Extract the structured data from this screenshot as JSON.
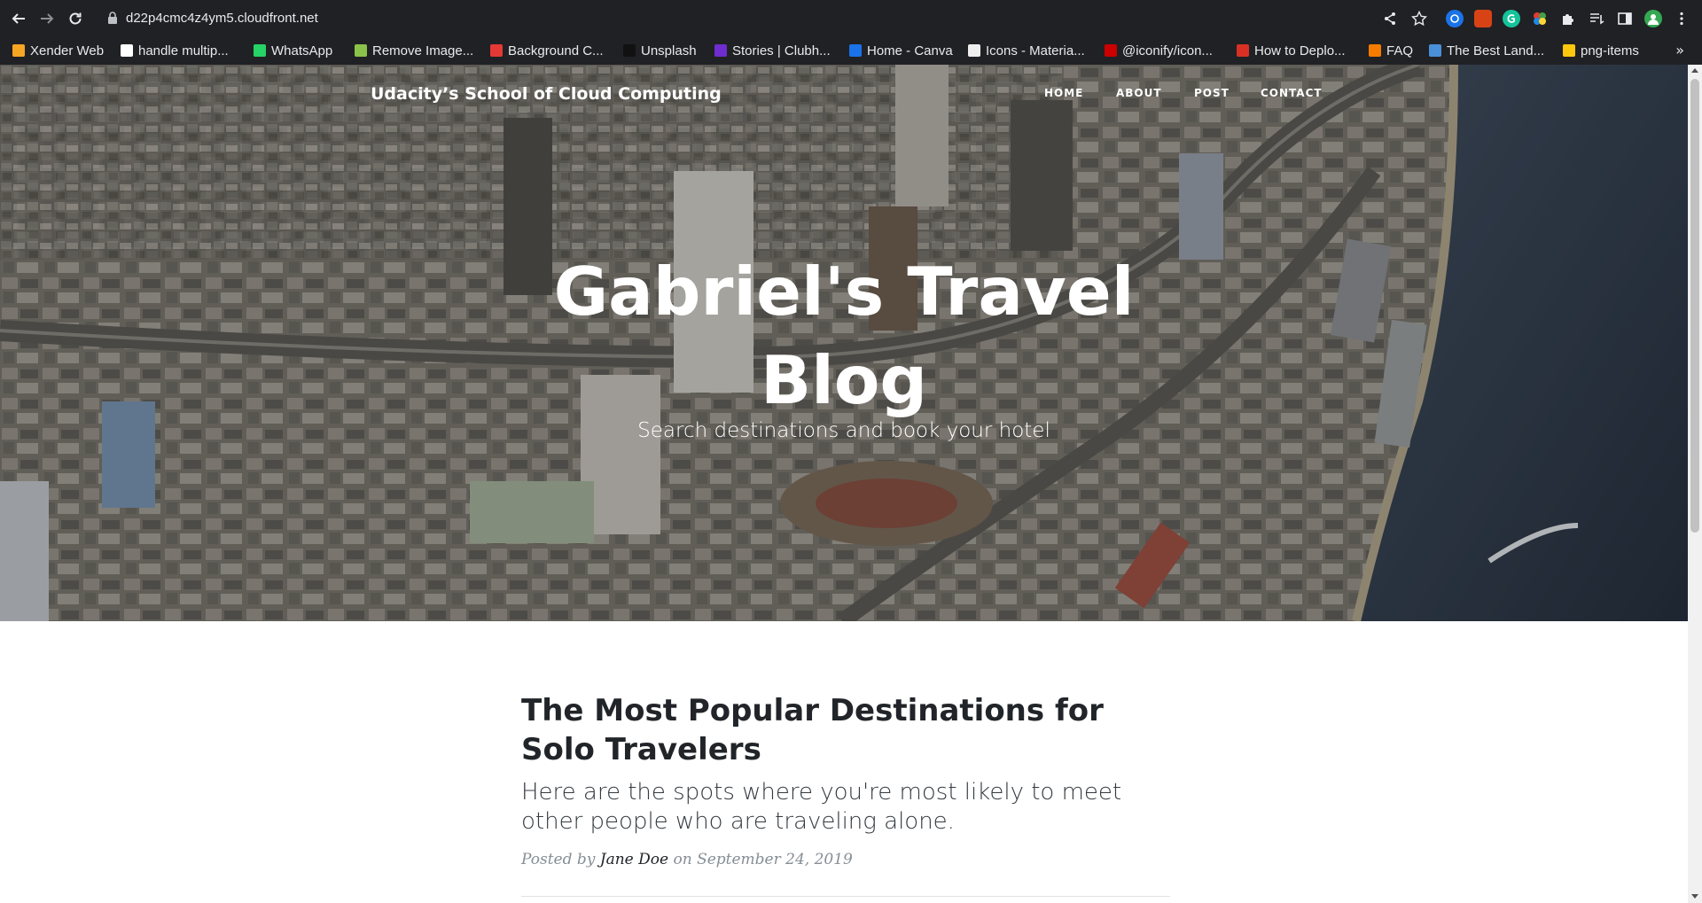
{
  "browser": {
    "url": "d22p4cmc4z4ym5.cloudfront.net",
    "bookmarks": [
      {
        "label": "Xender Web",
        "icon": "xender-icon",
        "color": "#f5a623"
      },
      {
        "label": "handle multip...",
        "icon": "google-icon",
        "color": "#ffffff"
      },
      {
        "label": "WhatsApp",
        "icon": "whatsapp-icon",
        "color": "#25d366"
      },
      {
        "label": "Remove Image...",
        "icon": "remove-bg-icon",
        "color": "#8bc34a"
      },
      {
        "label": "Background C...",
        "icon": "background-changer-icon",
        "color": "#e53935"
      },
      {
        "label": "Unsplash",
        "icon": "unsplash-icon",
        "color": "#111111"
      },
      {
        "label": "Stories | Clubh...",
        "icon": "clubhouse-icon",
        "color": "#6f2ccf"
      },
      {
        "label": "Home - Canva",
        "icon": "canva-icon",
        "color": "#1a73e8"
      },
      {
        "label": "Icons - Materia...",
        "icon": "material-icon",
        "color": "#eeeeee"
      },
      {
        "label": "@iconify/icon...",
        "icon": "npm-icon",
        "color": "#cb0000"
      },
      {
        "label": "How to Deplo...",
        "icon": "pen-icon",
        "color": "#d93025"
      },
      {
        "label": "FAQ",
        "icon": "faq-icon",
        "color": "#f57c00"
      },
      {
        "label": "The Best Land...",
        "icon": "landing-icon",
        "color": "#4a90d9"
      },
      {
        "label": "png-items",
        "icon": "png-items-icon",
        "color": "#f9c80e"
      }
    ],
    "more_label": "»"
  },
  "site": {
    "brand": "Udacity’s School of Cloud Computing",
    "nav": [
      {
        "label": "HOME"
      },
      {
        "label": "ABOUT"
      },
      {
        "label": "POST"
      },
      {
        "label": "CONTACT"
      }
    ]
  },
  "hero": {
    "title_line1": "Gabriel's Travel",
    "title_line2": "Blog",
    "subtitle": "Search destinations and book your hotel"
  },
  "post": {
    "title": "The Most Popular Destinations for Solo Travelers",
    "subtitle": "Here are the spots where you're most likely to meet other people who are traveling alone.",
    "meta_prefix": "Posted by",
    "author": "Jane Doe",
    "meta_on": "on",
    "date": "September 24, 2019"
  }
}
